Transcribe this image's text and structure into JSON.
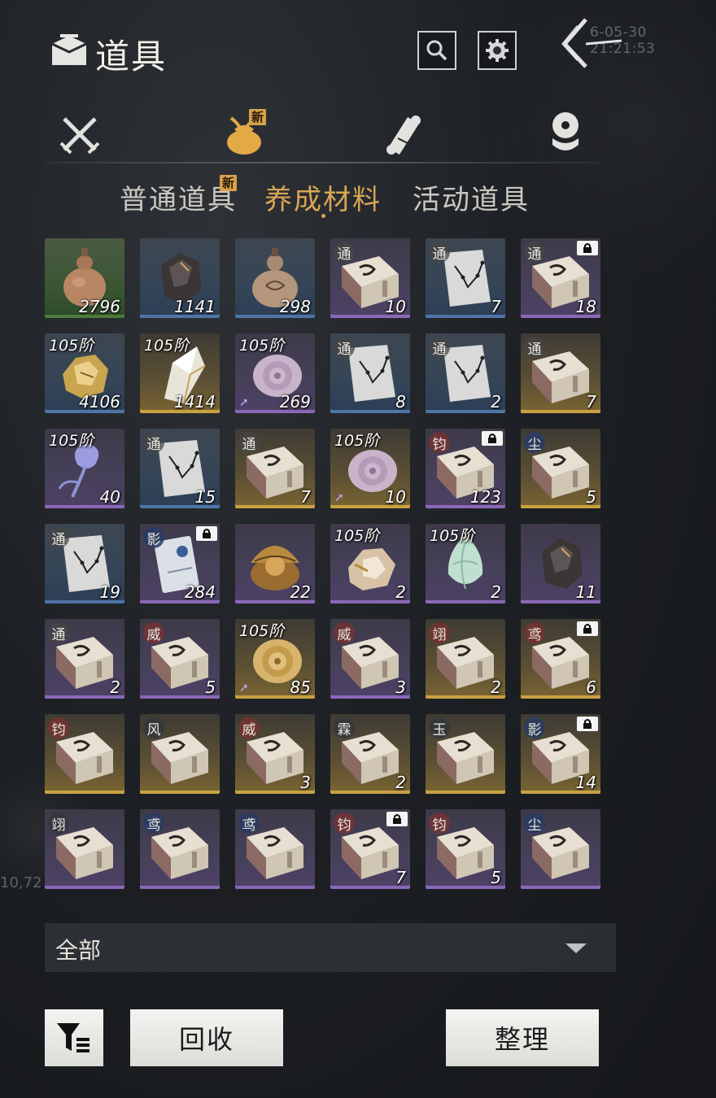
{
  "header": {
    "title": "道具",
    "timestamp": "6-05-30 21:21:53"
  },
  "categories": [
    {
      "name": "weapons",
      "new": false
    },
    {
      "name": "materials",
      "new": true,
      "badge": "新"
    },
    {
      "name": "scrolls",
      "new": false
    },
    {
      "name": "coins",
      "new": false
    }
  ],
  "subtabs": [
    {
      "label": "普通道具",
      "badge": "新",
      "active": false
    },
    {
      "label": "养成材料",
      "active": true
    },
    {
      "label": "活动道具",
      "active": false
    }
  ],
  "items": [
    {
      "rarity": "green",
      "kind": "gourd",
      "qty": "2796"
    },
    {
      "rarity": "blue",
      "kind": "ore-dark",
      "qty": "1141"
    },
    {
      "rarity": "blue",
      "kind": "gourd-pattern",
      "qty": "298"
    },
    {
      "rarity": "purple",
      "kind": "manual",
      "glyph": "通",
      "qty": "10"
    },
    {
      "rarity": "blue",
      "kind": "chart",
      "glyph": "通",
      "qty": "7"
    },
    {
      "rarity": "purple",
      "kind": "manual",
      "glyph": "通",
      "lock": true,
      "qty": "18"
    },
    {
      "rarity": "blue",
      "kind": "gold-ore",
      "tier": "105阶",
      "qty": "4106"
    },
    {
      "rarity": "gold",
      "kind": "crystal",
      "tier": "105阶",
      "qty": "1414"
    },
    {
      "rarity": "purple",
      "kind": "shell",
      "tier": "105阶",
      "upgrade": true,
      "qty": "269"
    },
    {
      "rarity": "blue",
      "kind": "chart",
      "glyph": "通",
      "qty": "8"
    },
    {
      "rarity": "blue",
      "kind": "chart",
      "glyph": "通",
      "qty": "2"
    },
    {
      "rarity": "gold",
      "kind": "manual",
      "glyph": "通",
      "qty": "7"
    },
    {
      "rarity": "purple",
      "kind": "flower",
      "tier": "105阶",
      "qty": "40"
    },
    {
      "rarity": "blue",
      "kind": "chart",
      "glyph": "通",
      "qty": "15"
    },
    {
      "rarity": "gold",
      "kind": "manual",
      "glyph": "通",
      "qty": "7"
    },
    {
      "rarity": "gold",
      "kind": "shell",
      "tier": "105阶",
      "upgrade": true,
      "qty": "10"
    },
    {
      "rarity": "purple",
      "kind": "manual",
      "glyph": "钧",
      "glyphStyle": "red",
      "lock": true,
      "qty": "123"
    },
    {
      "rarity": "gold",
      "kind": "manual",
      "glyph": "尘",
      "glyphStyle": "blue",
      "qty": "5"
    },
    {
      "rarity": "blue",
      "kind": "chart",
      "glyph": "通",
      "qty": "19"
    },
    {
      "rarity": "purple",
      "kind": "envelope",
      "glyph": "影",
      "glyphStyle": "blue",
      "lock": true,
      "qty": "284"
    },
    {
      "rarity": "purple",
      "kind": "orb",
      "qty": "22"
    },
    {
      "rarity": "purple",
      "kind": "gold-ore-pale",
      "tier": "105阶",
      "qty": "2"
    },
    {
      "rarity": "purple",
      "kind": "jade-bud",
      "tier": "105阶",
      "qty": "2"
    },
    {
      "rarity": "purple",
      "kind": "ore-dark",
      "qty": "11"
    },
    {
      "rarity": "purple",
      "kind": "manual",
      "glyph": "通",
      "qty": "2"
    },
    {
      "rarity": "purple",
      "kind": "manual",
      "glyph": "威",
      "glyphStyle": "red",
      "qty": "5"
    },
    {
      "rarity": "gold",
      "kind": "shell-gold",
      "tier": "105阶",
      "upgrade": true,
      "qty": "85"
    },
    {
      "rarity": "purple",
      "kind": "manual",
      "glyph": "威",
      "glyphStyle": "red",
      "qty": "3"
    },
    {
      "rarity": "gold",
      "kind": "manual",
      "glyph": "翊",
      "glyphStyle": "red",
      "qty": "2"
    },
    {
      "rarity": "gold",
      "kind": "manual",
      "glyph": "鸢",
      "glyphStyle": "red",
      "lock": true,
      "qty": "6"
    },
    {
      "rarity": "gold",
      "kind": "manual",
      "glyph": "钧",
      "glyphStyle": "red",
      "qty": ""
    },
    {
      "rarity": "gold",
      "kind": "manual",
      "glyph": "风",
      "glyphStyle": "dark",
      "qty": ""
    },
    {
      "rarity": "gold",
      "kind": "manual",
      "glyph": "威",
      "glyphStyle": "red",
      "qty": "3"
    },
    {
      "rarity": "gold",
      "kind": "manual",
      "glyph": "霖",
      "glyphStyle": "dark",
      "qty": "2"
    },
    {
      "rarity": "gold",
      "kind": "manual",
      "glyph": "玉",
      "glyphStyle": "dark",
      "qty": ""
    },
    {
      "rarity": "gold",
      "kind": "manual",
      "glyph": "影",
      "glyphStyle": "blue",
      "lock": true,
      "qty": "14"
    },
    {
      "rarity": "purple",
      "kind": "manual",
      "glyph": "翊",
      "glyphStyle": "dark",
      "qty": ""
    },
    {
      "rarity": "purple",
      "kind": "manual",
      "glyph": "鸢",
      "glyphStyle": "blue",
      "qty": ""
    },
    {
      "rarity": "purple",
      "kind": "manual",
      "glyph": "鸢",
      "glyphStyle": "blue",
      "qty": ""
    },
    {
      "rarity": "purple",
      "kind": "manual",
      "glyph": "钧",
      "glyphStyle": "red",
      "lock": true,
      "qty": "7"
    },
    {
      "rarity": "purple",
      "kind": "manual",
      "glyph": "钧",
      "glyphStyle": "red",
      "qty": "5"
    },
    {
      "rarity": "purple",
      "kind": "manual",
      "glyph": "尘",
      "glyphStyle": "blue",
      "qty": ""
    }
  ],
  "filter": {
    "selected": "全部"
  },
  "buttons": {
    "recycle": "回收",
    "sort": "整理"
  },
  "ghost": {
    "label": "10,72"
  }
}
